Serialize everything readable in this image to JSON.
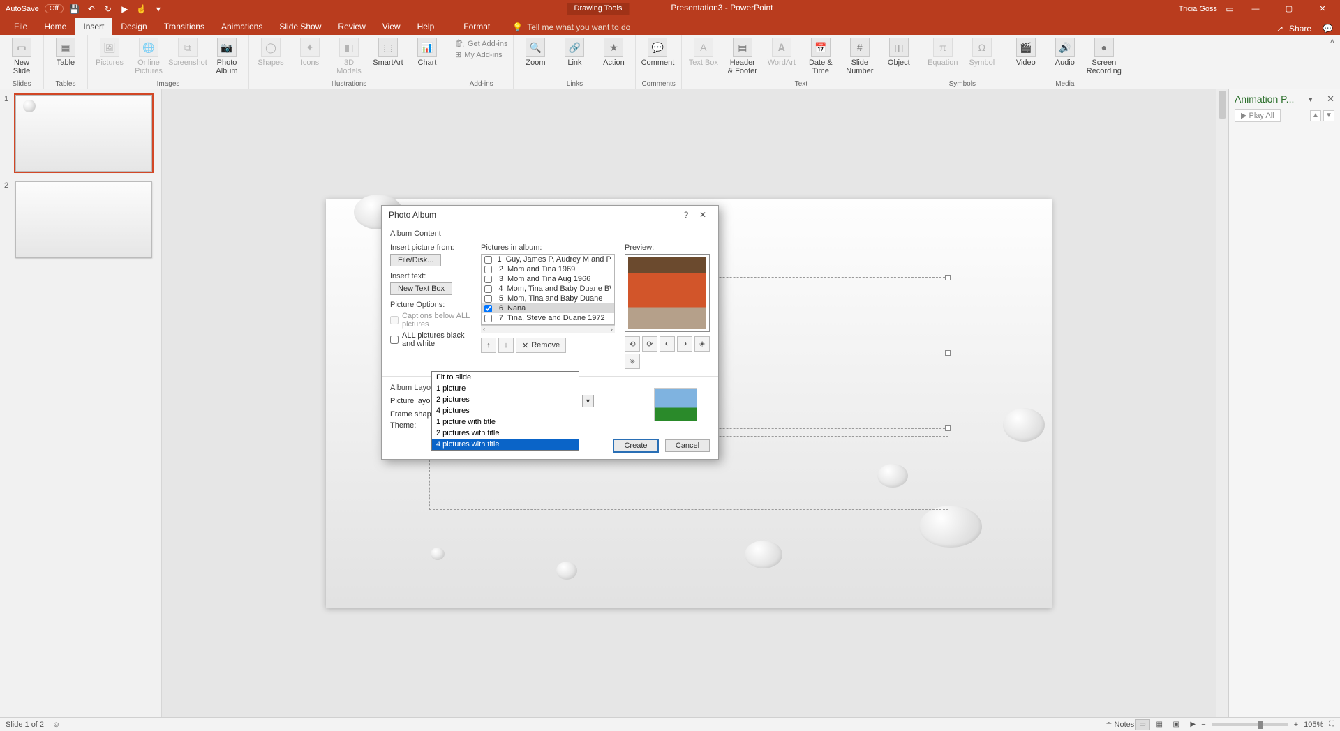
{
  "titlebar": {
    "autosave_label": "AutoSave",
    "autosave_state": "Off",
    "drawing_tools": "Drawing Tools",
    "doc_title": "Presentation3 - PowerPoint",
    "user": "Tricia Goss"
  },
  "tabs": {
    "file": "File",
    "home": "Home",
    "insert": "Insert",
    "design": "Design",
    "transitions": "Transitions",
    "animations": "Animations",
    "slideshow": "Slide Show",
    "review": "Review",
    "view": "View",
    "help": "Help",
    "format": "Format",
    "tellme": "Tell me what you want to do",
    "share": "Share"
  },
  "ribbon": {
    "new_slide": "New Slide",
    "table": "Table",
    "pictures": "Pictures",
    "online_pictures": "Online Pictures",
    "screenshot": "Screenshot",
    "photo_album": "Photo Album",
    "shapes": "Shapes",
    "icons": "Icons",
    "models": "3D Models",
    "smartart": "SmartArt",
    "chart": "Chart",
    "get_addins": "Get Add-ins",
    "my_addins": "My Add-ins",
    "zoom": "Zoom",
    "link": "Link",
    "action": "Action",
    "comment": "Comment",
    "text_box": "Text Box",
    "header_footer": "Header & Footer",
    "wordart": "WordArt",
    "date_time": "Date & Time",
    "slide_number": "Slide Number",
    "object": "Object",
    "equation": "Equation",
    "symbol": "Symbol",
    "video": "Video",
    "audio": "Audio",
    "screen_recording": "Screen Recording",
    "g_slides": "Slides",
    "g_tables": "Tables",
    "g_images": "Images",
    "g_illustrations": "Illustrations",
    "g_addins": "Add-ins",
    "g_links": "Links",
    "g_comments": "Comments",
    "g_text": "Text",
    "g_symbols": "Symbols",
    "g_media": "Media"
  },
  "thumbs": {
    "n1": "1",
    "n2": "2"
  },
  "anim": {
    "title": "Animation P...",
    "playall": "Play All"
  },
  "dialog": {
    "title": "Photo Album",
    "album_content": "Album Content",
    "insert_from": "Insert picture from:",
    "file_disk": "File/Disk...",
    "insert_text": "Insert text:",
    "new_text_box": "New Text Box",
    "picture_options": "Picture Options:",
    "captions_below": "Captions below ALL pictures",
    "all_bw": "ALL pictures black and white",
    "pictures_in_album": "Pictures in album:",
    "preview": "Preview:",
    "items": [
      {
        "n": "1",
        "name": "Guy, James P, Audrey M and Paul M Coll",
        "checked": false
      },
      {
        "n": "2",
        "name": "Mom and Tina 1969",
        "checked": false
      },
      {
        "n": "3",
        "name": "Mom and Tina Aug 1966",
        "checked": false
      },
      {
        "n": "4",
        "name": "Mom, Tina and Baby Duane BW",
        "checked": false
      },
      {
        "n": "5",
        "name": "Mom, Tina and Baby Duane",
        "checked": false
      },
      {
        "n": "6",
        "name": "Nana",
        "checked": true
      },
      {
        "n": "7",
        "name": "Tina, Steve and Duane 1972",
        "checked": false
      }
    ],
    "remove": "Remove",
    "album_layout": "Album Layout",
    "picture_layout": "Picture layout:",
    "picture_layout_value": "Fit to slide",
    "frame_shape": "Frame shape:",
    "theme": "Theme:",
    "layout_options": [
      "Fit to slide",
      "1 picture",
      "2 pictures",
      "4 pictures",
      "1 picture with title",
      "2 pictures with title",
      "4 pictures with title"
    ],
    "layout_highlight_index": 6,
    "create": "Create",
    "cancel": "Cancel"
  },
  "status": {
    "slide_of": "Slide 1 of 2",
    "notes": "Notes",
    "zoom": "105%"
  }
}
